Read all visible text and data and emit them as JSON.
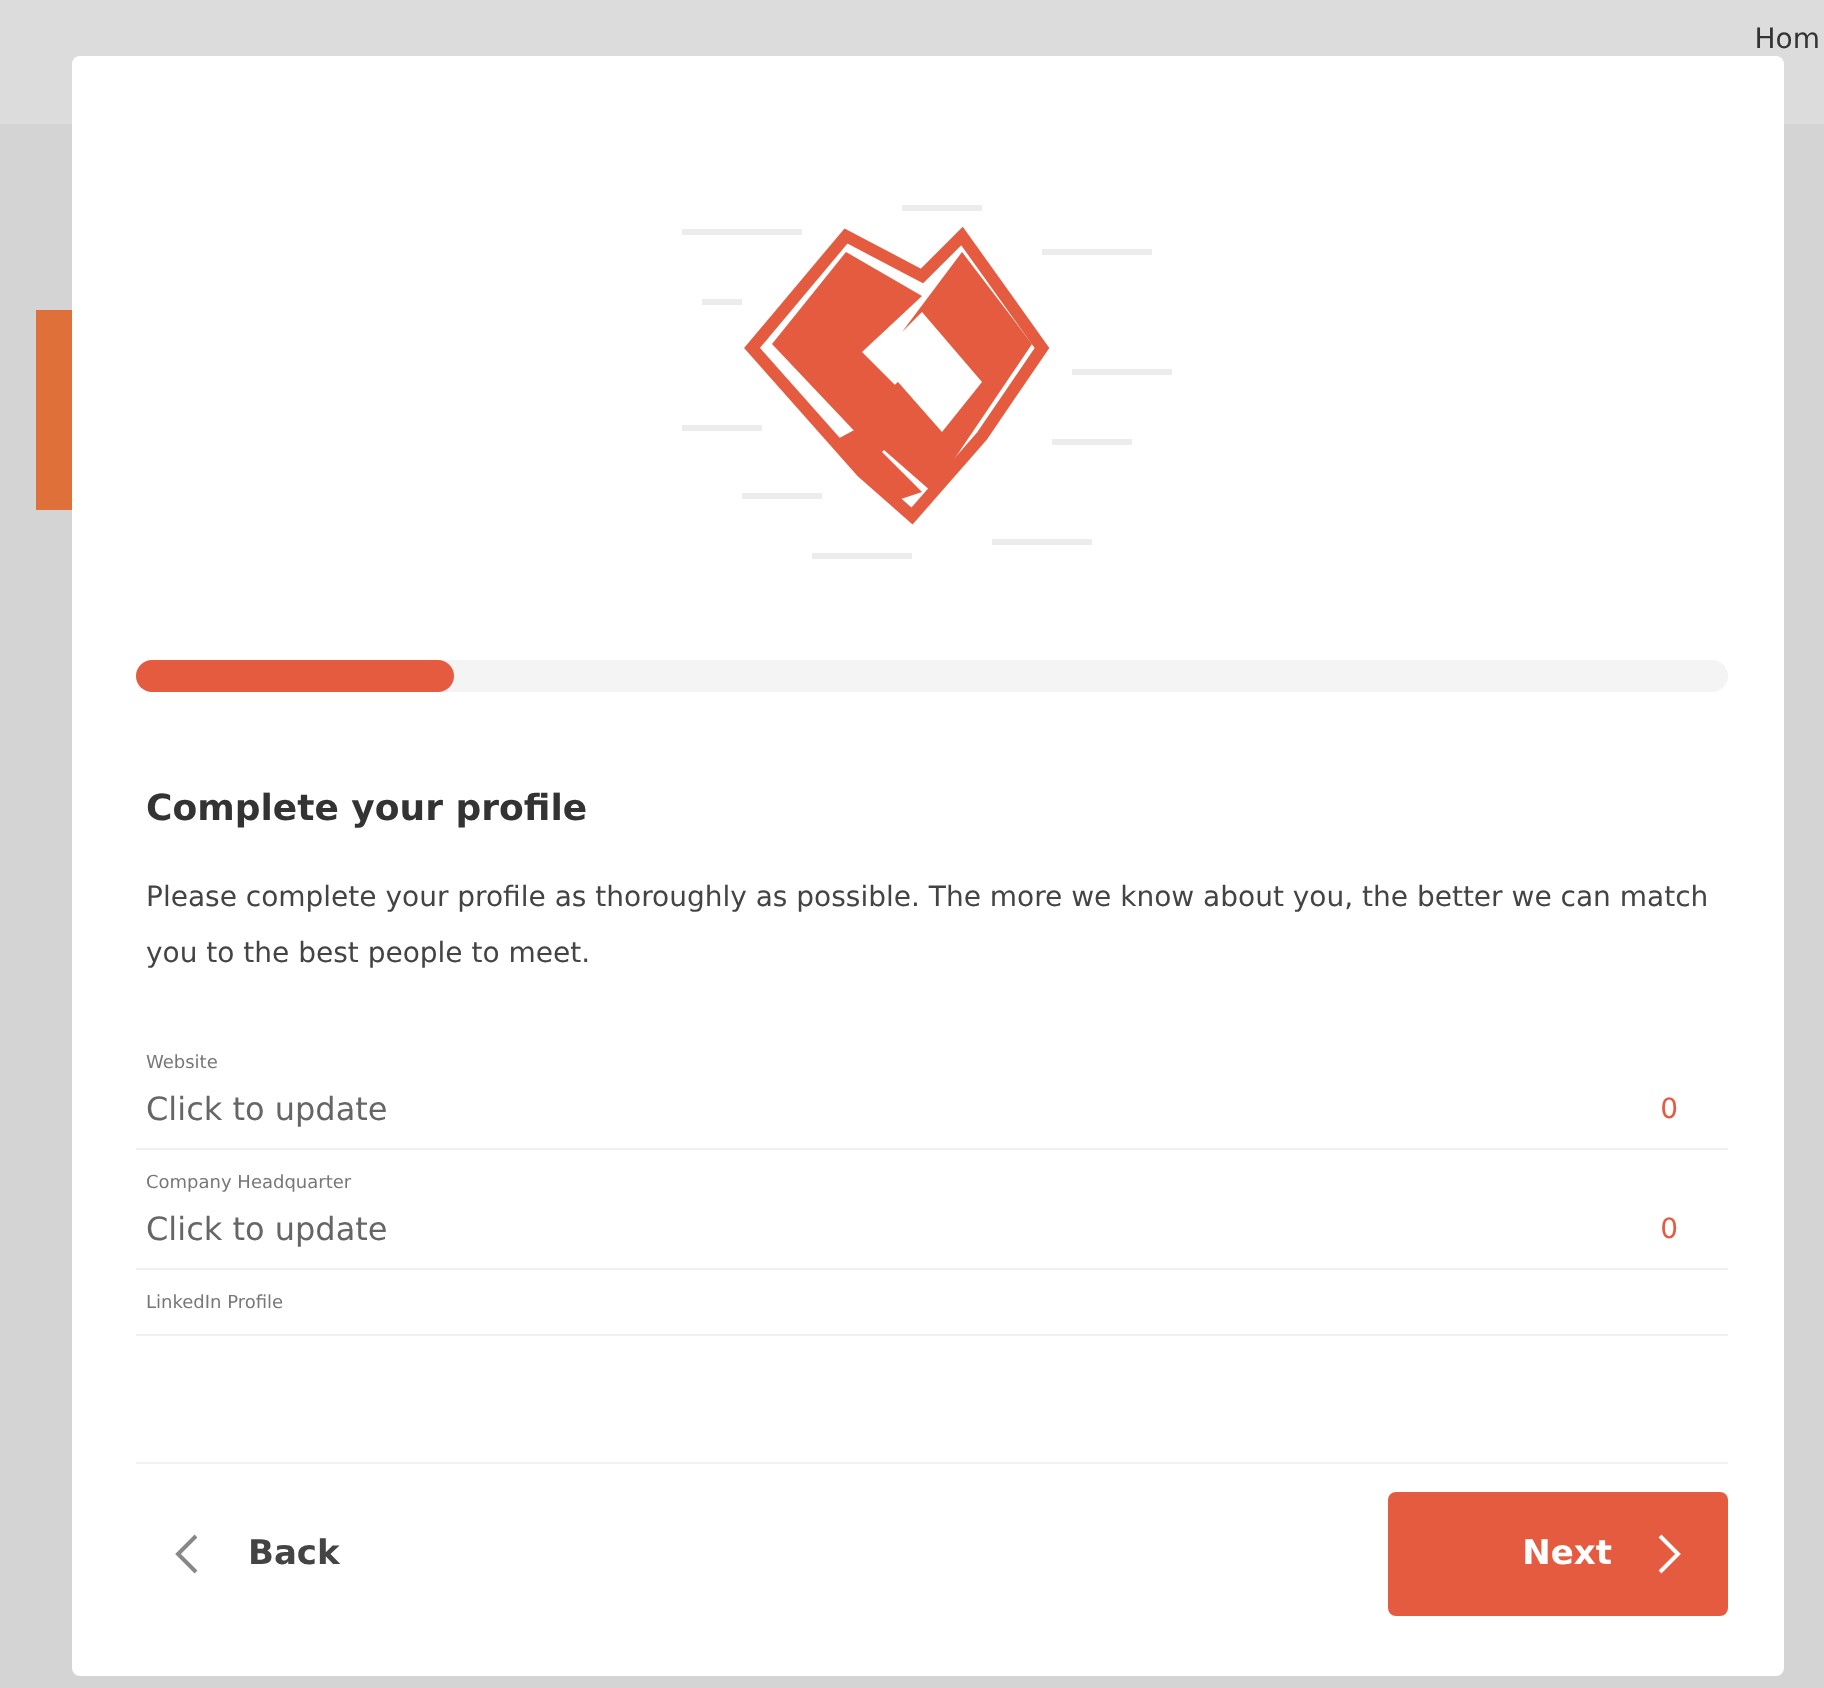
{
  "background": {
    "nav_link": "Hom"
  },
  "progress": {
    "level": 0.2
  },
  "title": "Complete your profile",
  "description": "Please complete your profile as thoroughly as possible. The more we know about you, the better we can match you to the best people to meet.",
  "fields": [
    {
      "label": "Website",
      "value": "Click to update",
      "count": "0"
    },
    {
      "label": "Company Headquarter",
      "value": "Click to update",
      "count": "0"
    },
    {
      "label": "LinkedIn Profile"
    }
  ],
  "footer": {
    "back": "Back",
    "next": "Next"
  }
}
